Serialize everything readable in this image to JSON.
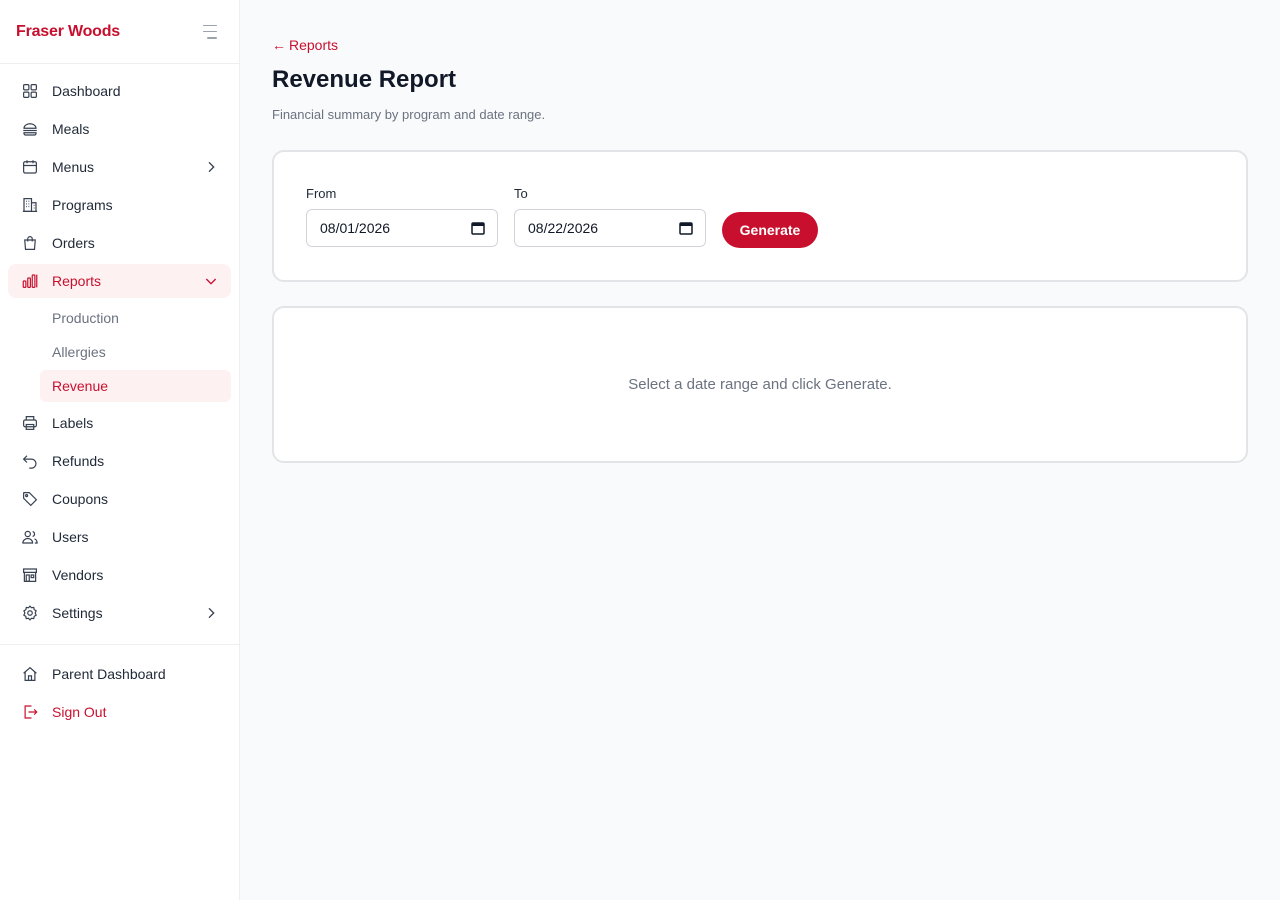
{
  "sidebar": {
    "brand": "Fraser Woods",
    "items": [
      {
        "label": "Dashboard"
      },
      {
        "label": "Meals"
      },
      {
        "label": "Menus"
      },
      {
        "label": "Programs"
      },
      {
        "label": "Orders"
      },
      {
        "label": "Reports"
      },
      {
        "label": "Labels"
      },
      {
        "label": "Refunds"
      },
      {
        "label": "Coupons"
      },
      {
        "label": "Users"
      },
      {
        "label": "Vendors"
      },
      {
        "label": "Settings"
      }
    ],
    "reports_sub": [
      {
        "label": "Production"
      },
      {
        "label": "Allergies"
      },
      {
        "label": "Revenue"
      }
    ],
    "footer": {
      "parent_dashboard": "Parent Dashboard",
      "sign_out": "Sign Out"
    }
  },
  "main": {
    "back_link": "Reports",
    "title": "Revenue Report",
    "subtitle": "Financial summary by program and date range.",
    "filters": {
      "from_label": "From",
      "from_value": "08/01/2026",
      "to_label": "To",
      "to_value": "08/22/2026",
      "generate_label": "Generate"
    },
    "empty_state": "Select a date range and click Generate."
  },
  "colors": {
    "brand": "#c8102e",
    "active_bg": "#fdf1f2",
    "page_bg": "#f9fafb"
  }
}
